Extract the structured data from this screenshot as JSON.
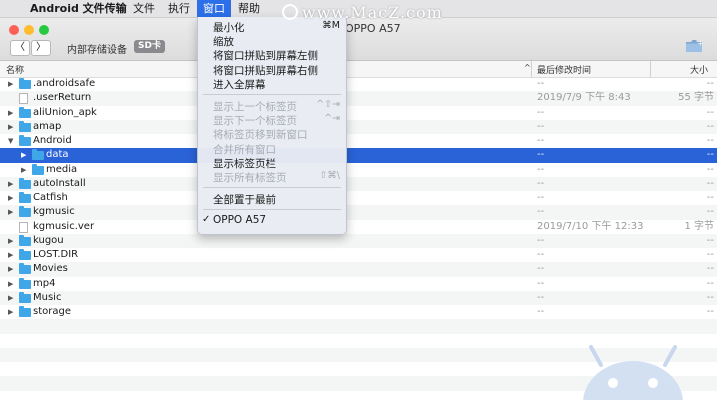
{
  "menubar": {
    "apple": "",
    "app_name": "Android 文件传输",
    "items": [
      "文件",
      "执行",
      "窗口",
      "帮助"
    ]
  },
  "watermark": "www.MacZ.com",
  "window": {
    "title": "OPPO A57",
    "location": "内部存储设备",
    "badge": "SD卡",
    "nav_back": "〈",
    "nav_forward": "〉"
  },
  "columns": {
    "name": "名称",
    "date": "最后修改时间",
    "size": "大小"
  },
  "files": [
    {
      "name": ".androidsafe",
      "kind": "folder",
      "date": "--",
      "size": "--",
      "expanded": false
    },
    {
      "name": ".userReturn",
      "kind": "file",
      "date": "2019/7/9 下午 8:43",
      "size": "55 字节"
    },
    {
      "name": "aliUnion_apk",
      "kind": "folder",
      "date": "--",
      "size": "--",
      "expanded": false
    },
    {
      "name": "amap",
      "kind": "folder",
      "date": "--",
      "size": "--",
      "expanded": false
    },
    {
      "name": "Android",
      "kind": "folder",
      "date": "--",
      "size": "--",
      "expanded": true
    },
    {
      "name": "data",
      "kind": "folder",
      "date": "--",
      "size": "--",
      "expanded": false,
      "selected": true,
      "indent": 1
    },
    {
      "name": "media",
      "kind": "folder",
      "date": "--",
      "size": "--",
      "expanded": false,
      "indent": 1
    },
    {
      "name": "autoInstall",
      "kind": "folder",
      "date": "--",
      "size": "--",
      "expanded": false
    },
    {
      "name": "Catfish",
      "kind": "folder",
      "date": "--",
      "size": "--",
      "expanded": false
    },
    {
      "name": "kgmusic",
      "kind": "folder",
      "date": "--",
      "size": "--",
      "expanded": false
    },
    {
      "name": "kgmusic.ver",
      "kind": "file",
      "date": "2019/7/10 下午 12:33",
      "size": "1 字节"
    },
    {
      "name": "kugou",
      "kind": "folder",
      "date": "--",
      "size": "--",
      "expanded": false
    },
    {
      "name": "LOST.DIR",
      "kind": "folder",
      "date": "--",
      "size": "--",
      "expanded": false
    },
    {
      "name": "Movies",
      "kind": "folder",
      "date": "--",
      "size": "--",
      "expanded": false
    },
    {
      "name": "mp4",
      "kind": "folder",
      "date": "--",
      "size": "--",
      "expanded": false
    },
    {
      "name": "Music",
      "kind": "folder",
      "date": "--",
      "size": "--",
      "expanded": false
    },
    {
      "name": "storage",
      "kind": "folder",
      "date": "--",
      "size": "--",
      "expanded": false
    }
  ],
  "window_menu": {
    "groups": [
      [
        {
          "label": "最小化",
          "shortcut": "⌘M",
          "enabled": true
        },
        {
          "label": "缩放",
          "shortcut": "",
          "enabled": true
        },
        {
          "label": "将窗口拼贴到屏幕左侧",
          "shortcut": "",
          "enabled": true
        },
        {
          "label": "将窗口拼贴到屏幕右侧",
          "shortcut": "",
          "enabled": true
        },
        {
          "label": "进入全屏幕",
          "shortcut": "",
          "enabled": true
        }
      ],
      [
        {
          "label": "显示上一个标签页",
          "shortcut": "^⇧⇥",
          "enabled": false
        },
        {
          "label": "显示下一个标签页",
          "shortcut": "^⇥",
          "enabled": false
        },
        {
          "label": "将标签页移到新窗口",
          "shortcut": "",
          "enabled": false
        },
        {
          "label": "合并所有窗口",
          "shortcut": "",
          "enabled": false
        },
        {
          "label": "显示标签页栏",
          "shortcut": "",
          "enabled": true
        },
        {
          "label": "显示所有标签页",
          "shortcut": "⇧⌘\\",
          "enabled": false
        }
      ],
      [
        {
          "label": "全部置于最前",
          "shortcut": "",
          "enabled": true
        }
      ],
      [
        {
          "label": "OPPO A57",
          "shortcut": "",
          "enabled": true,
          "checked": true,
          "check_mark": "✓"
        }
      ]
    ]
  },
  "colors": {
    "accent": "#2c6fe8",
    "selection": "#2a62d8",
    "folder": "#3fa7e8",
    "traffic_red": "#fe5f57",
    "traffic_yellow": "#febc2e",
    "traffic_green": "#28c840"
  }
}
